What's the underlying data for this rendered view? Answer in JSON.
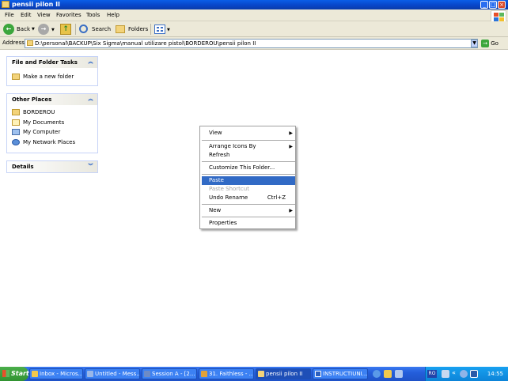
{
  "window": {
    "title": "pensii pilon II"
  },
  "menubar": {
    "items": [
      "File",
      "Edit",
      "View",
      "Favorites",
      "Tools",
      "Help"
    ]
  },
  "toolbar": {
    "back_label": "Back",
    "search_label": "Search",
    "folders_label": "Folders"
  },
  "address": {
    "label": "Address",
    "value": "D:\\personal\\BACKUP\\Six Sigma\\manual utilizare pistol\\BORDEROU\\pensii pilon II",
    "go_label": "Go"
  },
  "sidebar": {
    "file_tasks": {
      "title": "File and Folder Tasks",
      "items": [
        "Make a new folder"
      ]
    },
    "other_places": {
      "title": "Other Places",
      "items": [
        "BORDEROU",
        "My Documents",
        "My Computer",
        "My Network Places"
      ]
    },
    "details": {
      "title": "Details"
    }
  },
  "context_menu": {
    "items": [
      {
        "label": "View",
        "submenu": true
      },
      {
        "label": "Arrange Icons By",
        "submenu": true
      },
      {
        "label": "Refresh"
      },
      {
        "label": "Customize This Folder..."
      },
      {
        "label": "Paste",
        "selected": true
      },
      {
        "label": "Paste Shortcut",
        "disabled": true
      },
      {
        "label": "Undo Rename",
        "shortcut": "Ctrl+Z"
      },
      {
        "label": "New",
        "submenu": true
      },
      {
        "label": "Properties"
      }
    ]
  },
  "taskbar": {
    "start_label": "Start",
    "tasks": [
      {
        "label": "Inbox - Micros...",
        "color": "#f2c94c"
      },
      {
        "label": "Untitled - Mess...",
        "color": "#9ab7e8"
      },
      {
        "label": "Session A - [2...",
        "color": "#6d8bc6"
      },
      {
        "label": "31. Faithless - ...",
        "color": "#e0a23a"
      },
      {
        "label": "pensii pilon II",
        "color": "#f3d37a",
        "active": true
      },
      {
        "label": "INSTRUCTIUNI...",
        "color": "#2b5fbf"
      }
    ],
    "language": "RO",
    "clock": "14:55"
  },
  "colors": {
    "title_blue": "#0a5ee8",
    "link_blue": "#215dc6",
    "selection": "#316ac5",
    "taskbar_blue": "#245edb",
    "start_green": "#329332"
  }
}
